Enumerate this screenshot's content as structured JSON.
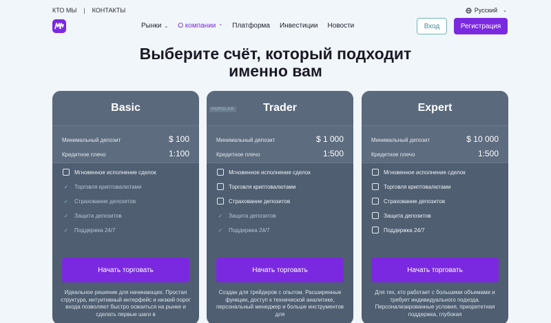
{
  "topbar": {
    "about": "КТО МЫ",
    "separator": "|",
    "contacts": "КОНТАКТЫ",
    "language": "Русский"
  },
  "nav": [
    {
      "label": "Рынки",
      "dropdown": true,
      "active": false
    },
    {
      "label": "О компании",
      "dropdown": true,
      "active": true
    },
    {
      "label": "Платформа",
      "dropdown": false,
      "active": false
    },
    {
      "label": "Инвестиции",
      "dropdown": false,
      "active": false
    },
    {
      "label": "Новости",
      "dropdown": false,
      "active": false
    }
  ],
  "auth": {
    "login": "Вход",
    "register": "Регистрация"
  },
  "headline": {
    "line1": "Выберите счёт, который подходит",
    "line2": "именно вам"
  },
  "plans": [
    {
      "name": "Basic",
      "badge": "",
      "min_deposit_label": "Минимальный депозит",
      "min_deposit": "$ 100",
      "leverage_label": "Кредитное плечо",
      "leverage": "1:100",
      "features": [
        {
          "label": "Мгновенное исполнение сделок",
          "state": "box"
        },
        {
          "label": "Торговля криптовалютами",
          "state": "check"
        },
        {
          "label": "Страхование депозитов",
          "state": "check"
        },
        {
          "label": "Защита депозитов",
          "state": "check"
        },
        {
          "label": "Поддержка 24/7",
          "state": "check"
        }
      ],
      "cta": "Начать торговать",
      "description": "Идеальное решение для начинающих. Простая структура, интуитивный интерфейс и низкий порог входа позволяют быстро освоиться на рынке и сделать первые шаги в"
    },
    {
      "name": "Trader",
      "badge": "POPULAR",
      "min_deposit_label": "Минимальный депозит",
      "min_deposit": "$ 1 000",
      "leverage_label": "Кредитное плечо",
      "leverage": "1:500",
      "features": [
        {
          "label": "Мгновенное исполнение сделок",
          "state": "box"
        },
        {
          "label": "Торговля криптовалютами",
          "state": "box"
        },
        {
          "label": "Страхование депозитов",
          "state": "box"
        },
        {
          "label": "Защита депозитов",
          "state": "check"
        },
        {
          "label": "Поддержка 24/7",
          "state": "check"
        }
      ],
      "cta": "Начать торговать",
      "description": "Создан для трейдеров с опытом. Расширенные функции, доступ к технической аналитике, персональный менеджер и больше инструментов для"
    },
    {
      "name": "Expert",
      "badge": "",
      "min_deposit_label": "Минимальный депозит",
      "min_deposit": "$ 10 000",
      "leverage_label": "Кредитное плечо",
      "leverage": "1:500",
      "features": [
        {
          "label": "Мгновенное исполнение сделок",
          "state": "box"
        },
        {
          "label": "Торговля криптовалютами",
          "state": "box"
        },
        {
          "label": "Страхование депозитов",
          "state": "box"
        },
        {
          "label": "Защита депозитов",
          "state": "box"
        },
        {
          "label": "Поддержка 24/7",
          "state": "box"
        }
      ],
      "cta": "Начать торговать",
      "description": "Для тех, кто работает с большими объемами и требует индивидуального подхода. Персонализированные условия, приоритетная поддержка, глубокая"
    }
  ],
  "colors": {
    "accent": "#7b29e0",
    "card_bg": "#4f5e71",
    "page_bg": "#f1f6fa",
    "login_border": "#6fb3b8"
  },
  "icons": {
    "language": "globe-icon",
    "dropdown": "chevron-down-icon",
    "logo": "brand-logo-icon"
  }
}
